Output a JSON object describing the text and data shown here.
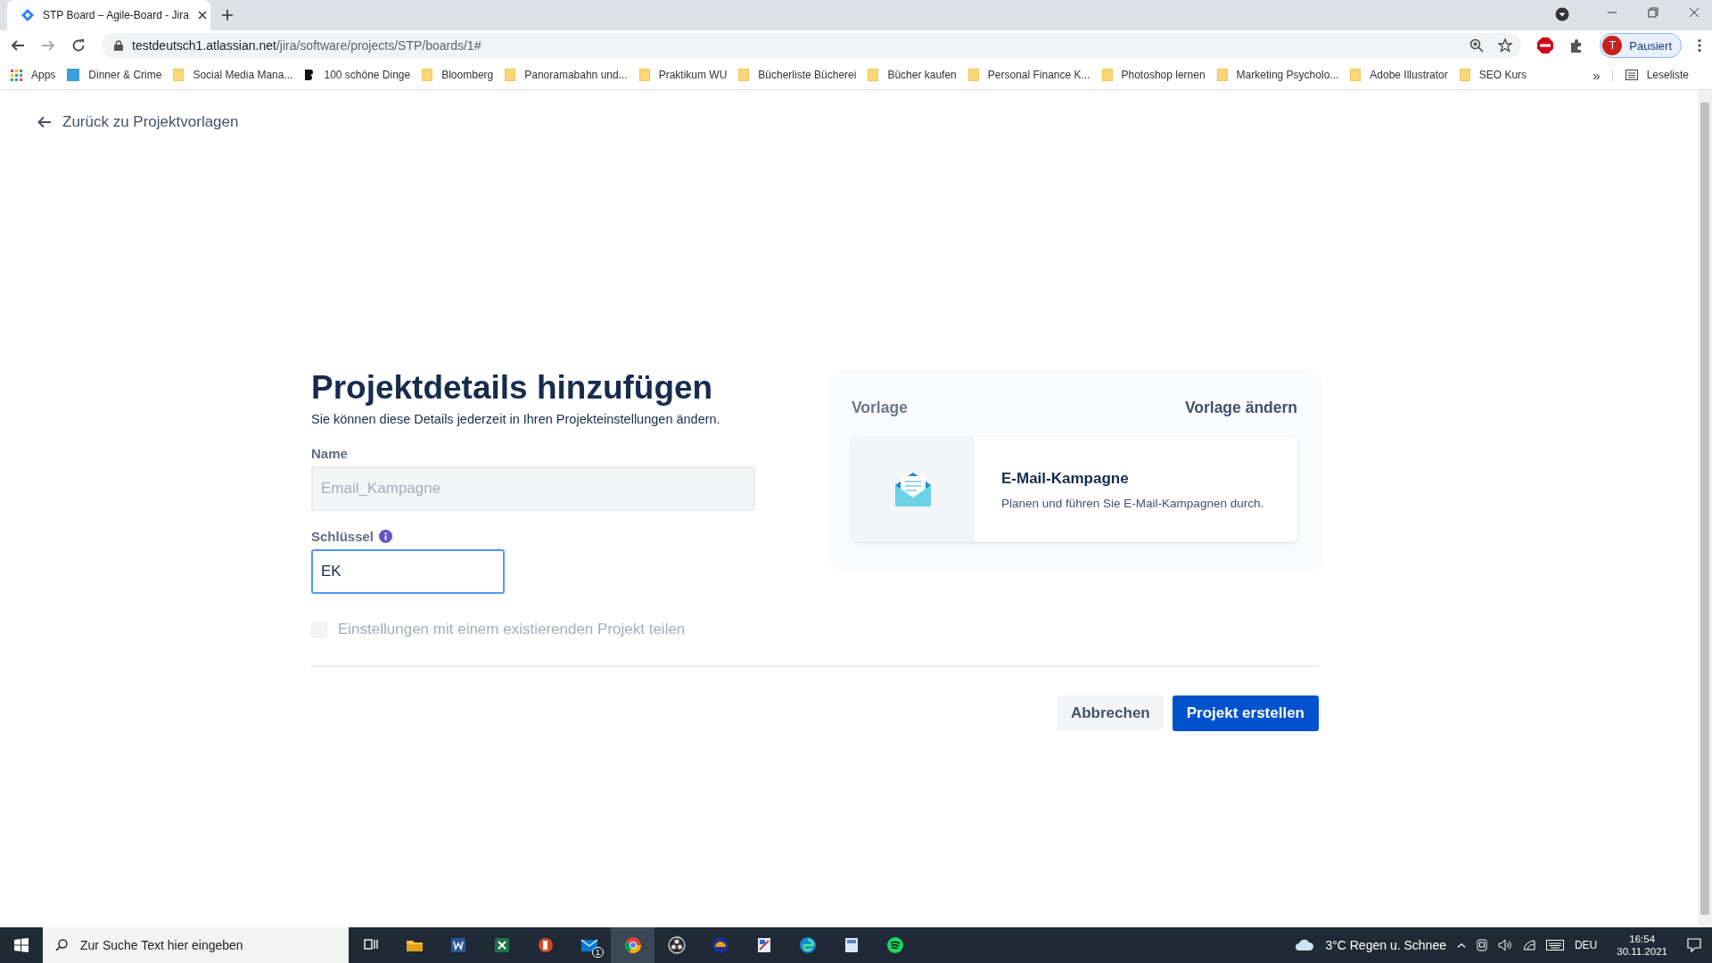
{
  "browser": {
    "tab": {
      "title": "STP Board – Agile-Board - Jira",
      "selected": true
    },
    "url_host": "testdeutsch1.atlassian.net",
    "url_path": "/jira/software/projects/STP/boards/1#",
    "profile": {
      "initial": "T",
      "label": "Pausiert"
    },
    "bookmarks": [
      {
        "label": "Apps",
        "kind": "apps"
      },
      {
        "label": "Dinner & Crime",
        "kind": "jd"
      },
      {
        "label": "Social Media Mana...",
        "kind": "folder"
      },
      {
        "label": "100 schöne Dinge",
        "kind": "b"
      },
      {
        "label": "Bloomberg",
        "kind": "folder"
      },
      {
        "label": "Panoramabahn und...",
        "kind": "folder"
      },
      {
        "label": "Praktikum WU",
        "kind": "folder"
      },
      {
        "label": "Bücherliste Bücherei",
        "kind": "folder"
      },
      {
        "label": "Bücher kaufen",
        "kind": "folder"
      },
      {
        "label": "Personal Finance K...",
        "kind": "folder"
      },
      {
        "label": "Photoshop lernen",
        "kind": "folder"
      },
      {
        "label": "Marketing Psycholo...",
        "kind": "folder"
      },
      {
        "label": "Adobe Illustrator",
        "kind": "folder"
      },
      {
        "label": "SEO Kurs",
        "kind": "folder"
      }
    ],
    "more": "»",
    "reading_list": "Leseliste"
  },
  "page": {
    "back_link": "Zurück zu Projektvorlagen",
    "title": "Projektdetails hinzufügen",
    "subtitle": "Sie können diese Details jederzeit in Ihren Projekteinstellungen ändern.",
    "name_field": {
      "label": "Name",
      "value": "Email_Kampagne",
      "disabled": true
    },
    "key_field": {
      "label": "Schlüssel",
      "value": "EK",
      "focused": true
    },
    "share_checkbox": {
      "label": "Einstellungen mit einem existierenden Projekt teilen",
      "checked": false,
      "disabled": true
    },
    "template": {
      "heading": "Vorlage",
      "change_link": "Vorlage ändern",
      "name": "E-Mail-Kampagne",
      "description": "Planen und führen Sie E-Mail-Kampagnen durch."
    },
    "buttons": [
      {
        "label": "Abbrechen",
        "kind": "secondary"
      },
      {
        "label": "Projekt erstellen",
        "kind": "primary"
      }
    ]
  },
  "taskbar": {
    "search_placeholder": "Zur Suche Text hier eingeben",
    "apps": [
      {
        "kind": "taskview"
      },
      {
        "kind": "explorer"
      },
      {
        "kind": "word"
      },
      {
        "kind": "excel"
      },
      {
        "kind": "powerpoint"
      },
      {
        "kind": "mail",
        "badge": "1"
      },
      {
        "kind": "chrome",
        "selected": true
      },
      {
        "kind": "obs"
      },
      {
        "kind": "app1"
      },
      {
        "kind": "app2"
      },
      {
        "kind": "edge"
      },
      {
        "kind": "app3"
      },
      {
        "kind": "spotify"
      }
    ],
    "weather": "3°C  Regen u. Schnee",
    "language": "DEU",
    "time": "16:54",
    "date": "30.11.2021"
  }
}
